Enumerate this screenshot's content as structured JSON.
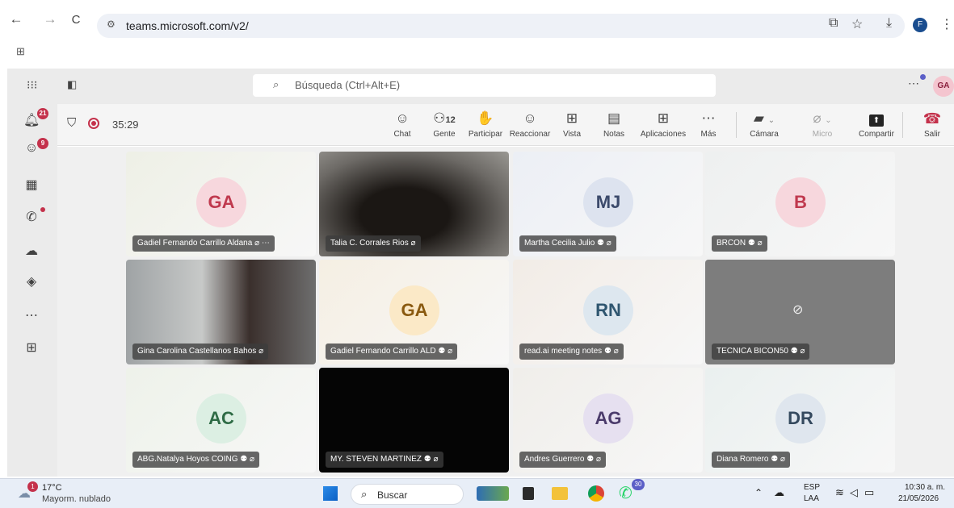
{
  "browser": {
    "url": "teams.microsoft.com/v2/",
    "back_icon": "←",
    "forward_icon": "→",
    "reload_icon": "C",
    "profile_initial": "F"
  },
  "teams": {
    "search_placeholder": "Búsqueda (Ctrl+Alt+E)",
    "user_initials": "GA",
    "rail_badges": {
      "activity": "21",
      "chat": "9"
    }
  },
  "meeting": {
    "timer": "35:29",
    "people_count": "12",
    "toolbar": [
      {
        "name": "chat",
        "label": "Chat",
        "icon": "☺"
      },
      {
        "name": "people",
        "label": "Gente",
        "icon": "⚇"
      },
      {
        "name": "raise-hand",
        "label": "Participar",
        "icon": "✋"
      },
      {
        "name": "react",
        "label": "Reaccionar",
        "icon": "☺"
      },
      {
        "name": "view",
        "label": "Vista",
        "icon": "⊞"
      },
      {
        "name": "notes",
        "label": "Notas",
        "icon": "▤"
      },
      {
        "name": "apps",
        "label": "Aplicaciones",
        "icon": "⊞"
      },
      {
        "name": "more",
        "label": "Más",
        "icon": "⋯"
      },
      {
        "name": "camera",
        "label": "Cámara",
        "icon": "▰"
      },
      {
        "name": "mic",
        "label": "Micro",
        "icon": "⌀"
      },
      {
        "name": "share",
        "label": "Compartir",
        "icon": "⬆"
      },
      {
        "name": "leave",
        "label": "Salir",
        "icon": "☎"
      }
    ],
    "participants": [
      {
        "name": "Gadiel Fernando Carrillo Aldana",
        "initials": "GA",
        "avatar_bg": "#f7d7dd",
        "avatar_fg": "#c0394e",
        "tile_bg": "#eef0e6"
      },
      {
        "name": "Talia C. Corrales Rios",
        "initials": "",
        "avatar_bg": "",
        "avatar_fg": "",
        "tile_bg": "#3a3530"
      },
      {
        "name": "Martha Cecilia Julio",
        "initials": "MJ",
        "avatar_bg": "#dde3ef",
        "avatar_fg": "#3b4a6b",
        "tile_bg": "#eceff5"
      },
      {
        "name": "BRCON",
        "initials": "B",
        "avatar_bg": "#f7d7dd",
        "avatar_fg": "#c0394e",
        "tile_bg": "#eef0f0"
      },
      {
        "name": "Gina Carolina Castellanos Bahos",
        "initials": "",
        "avatar_bg": "",
        "avatar_fg": "",
        "tile_bg": "#6b6f72"
      },
      {
        "name": "Gadiel Fernando Carrillo ALD",
        "initials": "GA",
        "avatar_bg": "#fbe9c7",
        "avatar_fg": "#8a5a10",
        "tile_bg": "#f5efe3"
      },
      {
        "name": "read.ai meeting notes",
        "initials": "RN",
        "avatar_bg": "#dde7ef",
        "avatar_fg": "#2f5670",
        "tile_bg": "#f2ece6"
      },
      {
        "name": "TECNICA BICON50",
        "initials": "",
        "avatar_bg": "",
        "avatar_fg": "",
        "tile_bg": "#7d7d7d"
      },
      {
        "name": "ABG.Natalya Hoyos COING",
        "initials": "AC",
        "avatar_bg": "#dcefe3",
        "avatar_fg": "#2e6b45",
        "tile_bg": "#eef2ea"
      },
      {
        "name": "MY. STEVEN MARTINEZ",
        "initials": "",
        "avatar_bg": "",
        "avatar_fg": "",
        "tile_bg": "#050505"
      },
      {
        "name": "Andres Guerrero",
        "initials": "AG",
        "avatar_bg": "#e6e0f0",
        "avatar_fg": "#4b3b6b",
        "tile_bg": "#f0eeea"
      },
      {
        "name": "Diana Romero",
        "initials": "DR",
        "avatar_bg": "#dfe6ee",
        "avatar_fg": "#34495e",
        "tile_bg": "#eaf0ef"
      }
    ]
  },
  "taskbar": {
    "weather_temp": "17°C",
    "weather_desc": "Mayorm. nublado",
    "weather_badge": "1",
    "search_label": "Buscar",
    "whatsapp_badge": "30",
    "lang": "ESP",
    "lang2": "LAA",
    "time": "10:30 a. m.",
    "date": "21/05/2026"
  }
}
